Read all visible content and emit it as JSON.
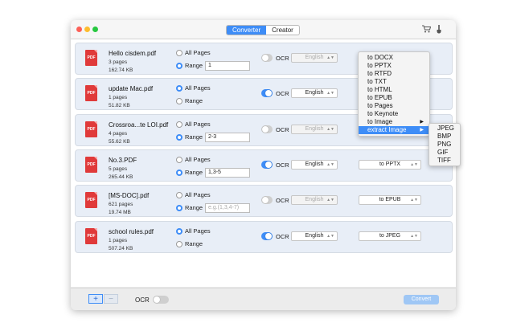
{
  "toolbar": {
    "tabs": [
      {
        "label": "Converter"
      },
      {
        "label": "Creator"
      }
    ],
    "cart_icon": "cart-icon",
    "brush_icon": "brush-icon"
  },
  "files": [
    {
      "name": "Hello cisdem.pdf",
      "pages": "3 pages",
      "size": "162.74 KB",
      "mode": "range",
      "all_label": "All Pages",
      "range_label": "Range",
      "range_value": "1",
      "ocr": false,
      "ocr_label": "OCR",
      "language": "English",
      "format": ""
    },
    {
      "name": "update Mac.pdf",
      "pages": "1 pages",
      "size": "51.82 KB",
      "mode": "all",
      "all_label": "All Pages",
      "range_label": "Range",
      "range_value": "",
      "ocr": true,
      "ocr_label": "OCR",
      "language": "English",
      "format": ""
    },
    {
      "name": "Crossroa...te LOI.pdf",
      "pages": "4 pages",
      "size": "55.62 KB",
      "mode": "range",
      "all_label": "All Pages",
      "range_label": "Range",
      "range_value": "2-3",
      "ocr": false,
      "ocr_label": "OCR",
      "language": "English",
      "format": ""
    },
    {
      "name": "No.3.PDF",
      "pages": "5 pages",
      "size": "265.44 KB",
      "mode": "range",
      "all_label": "All Pages",
      "range_label": "Range",
      "range_value": "1,3-5",
      "ocr": true,
      "ocr_label": "OCR",
      "language": "English",
      "format": "to PPTX"
    },
    {
      "name": "[MS-DOC].pdf",
      "pages": "621 pages",
      "size": "19.74 MB",
      "mode": "range",
      "all_label": "All Pages",
      "range_label": "Range",
      "range_value": "",
      "range_placeholder": "e.g.(1,3,4-7)",
      "ocr": false,
      "ocr_label": "OCR",
      "language": "English",
      "format": "to EPUB"
    },
    {
      "name": "school rules.pdf",
      "pages": "1 pages",
      "size": "507.24 KB",
      "mode": "all",
      "all_label": "All Pages",
      "range_label": "Range",
      "range_value": "",
      "ocr": true,
      "ocr_label": "OCR",
      "language": "English",
      "format": "to JPEG"
    }
  ],
  "menu": {
    "items": [
      "to DOCX",
      "to PPTX",
      "to RTFD",
      "to TXT",
      "to HTML",
      "to EPUB",
      "to Pages",
      "to Keynote",
      "to Image",
      "extract Image"
    ],
    "highlighted_index": 9,
    "submenu_items_with_arrow": [
      8,
      9
    ]
  },
  "submenu": {
    "items": [
      "JPEG",
      "BMP",
      "PNG",
      "GIF",
      "TIFF"
    ]
  },
  "footer": {
    "add_label": "+",
    "remove_label": "−",
    "ocr_label": "OCR",
    "convert_label": "Convert"
  },
  "pdf_icon_label": "PDF",
  "colors": {
    "accent": "#3e8df7",
    "pdf_red": "#e03a3a"
  }
}
